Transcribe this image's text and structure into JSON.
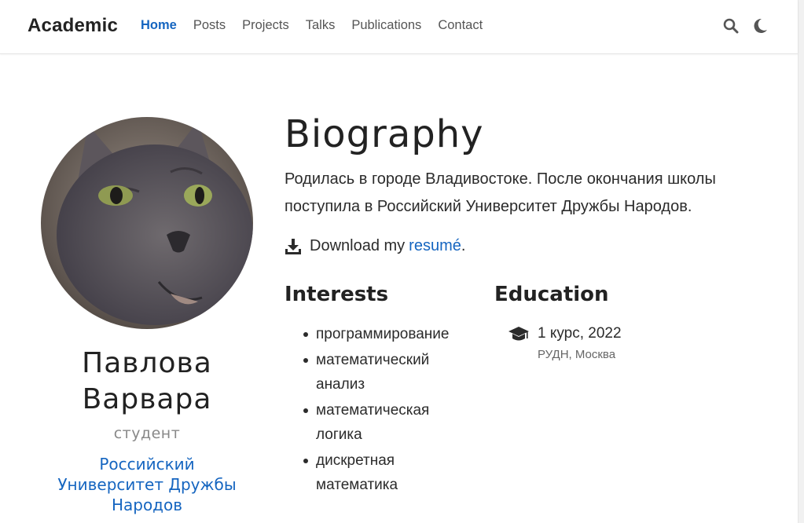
{
  "nav": {
    "brand": "Academic",
    "links": [
      "Home",
      "Posts",
      "Projects",
      "Talks",
      "Publications",
      "Contact"
    ],
    "search_icon": "search-icon",
    "theme_icon": "moon-icon",
    "accent": "#1565c0"
  },
  "profile": {
    "name_line1": "Павлова",
    "name_line2": "Варвара",
    "role": "студент",
    "org_line1": "Российский",
    "org_line2": "Университет Дружбы",
    "org_line3": "Народов"
  },
  "bio": {
    "title": "Biography",
    "text_line1": "Родилась в городе Владивостоке. После окончания школы",
    "text_line2": "поступила в Российский Университет Дружбы Народов.",
    "download_prefix": "Download my",
    "download_link": "resumé",
    "download_suffix": "."
  },
  "interests": {
    "title": "Interests",
    "items": [
      [
        "программирование"
      ],
      [
        "математический",
        "анализ"
      ],
      [
        "математическая",
        "логика"
      ],
      [
        "дискретная",
        "математика"
      ]
    ]
  },
  "education": {
    "title": "Education",
    "degree": "1 курс, 2022",
    "institution": "РУДН, Москва",
    "icon": "graduation-cap-icon"
  }
}
